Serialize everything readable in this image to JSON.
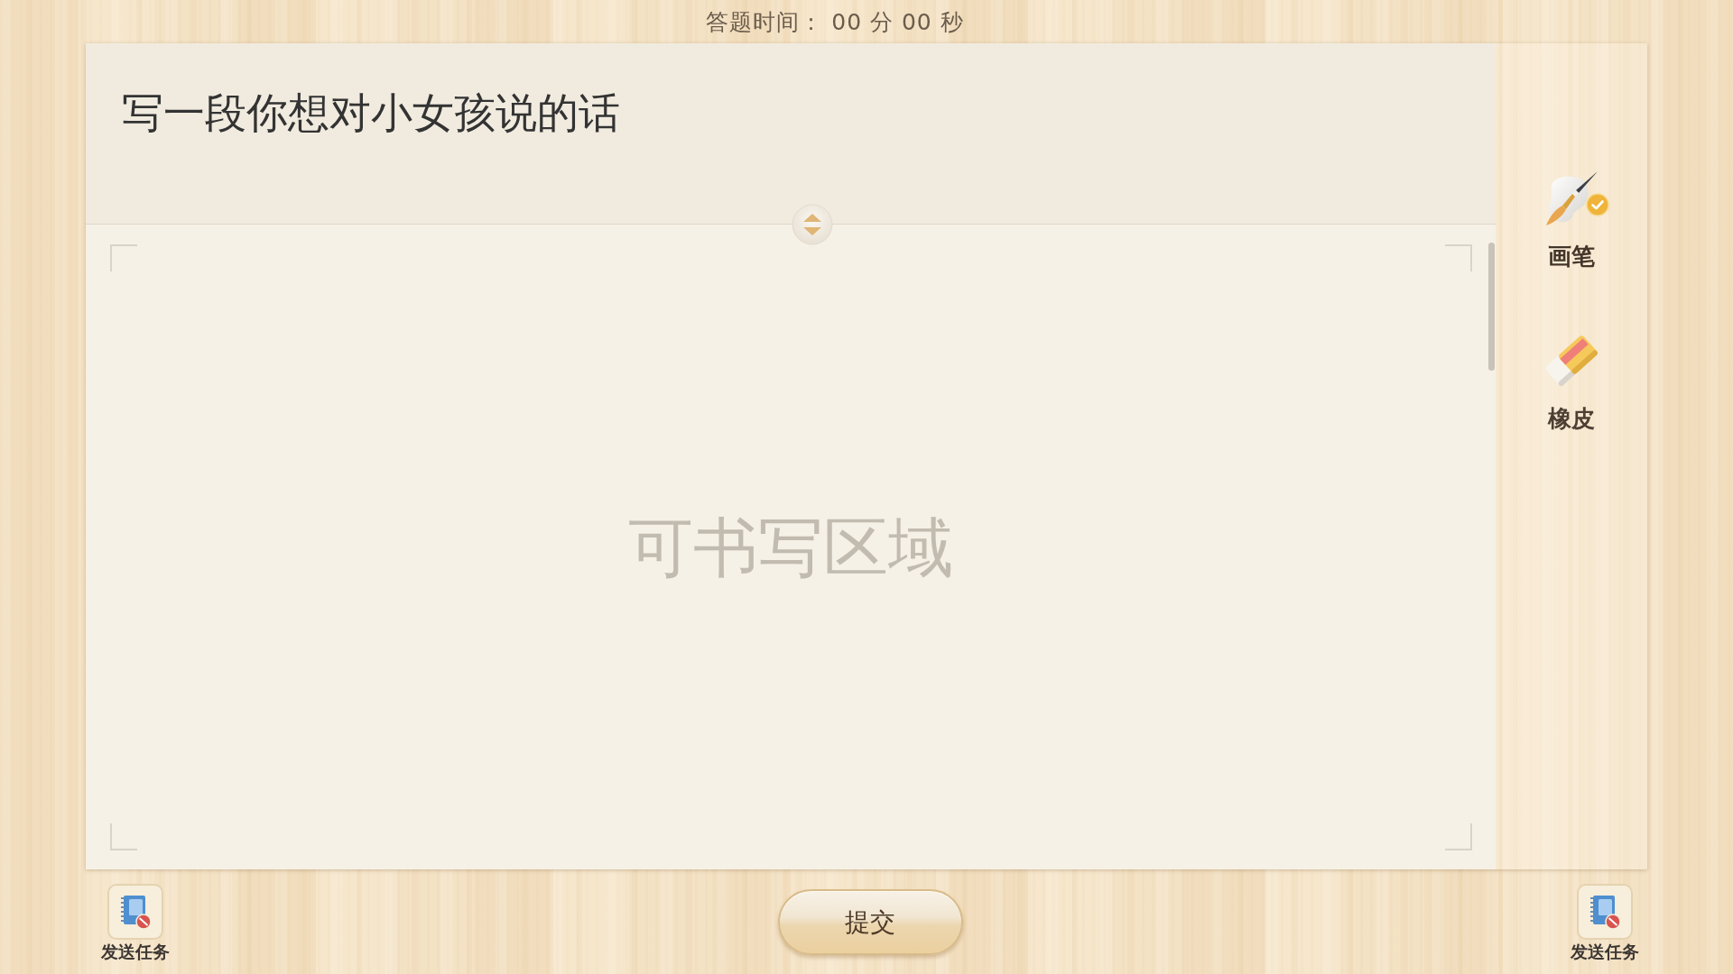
{
  "timer": "答题时间： 00 分 00 秒",
  "question": {
    "title": "写一段你想对小女孩说的话"
  },
  "writing_area": {
    "placeholder": "可书写区域"
  },
  "tools": [
    {
      "kind": "pen",
      "label": "画笔",
      "selected": true
    },
    {
      "kind": "eraser",
      "label": "橡皮",
      "selected": false
    }
  ],
  "send_task_buttons": [
    {
      "label": "发送任务"
    },
    {
      "label": "发送任务"
    }
  ],
  "submit_button": "提交"
}
